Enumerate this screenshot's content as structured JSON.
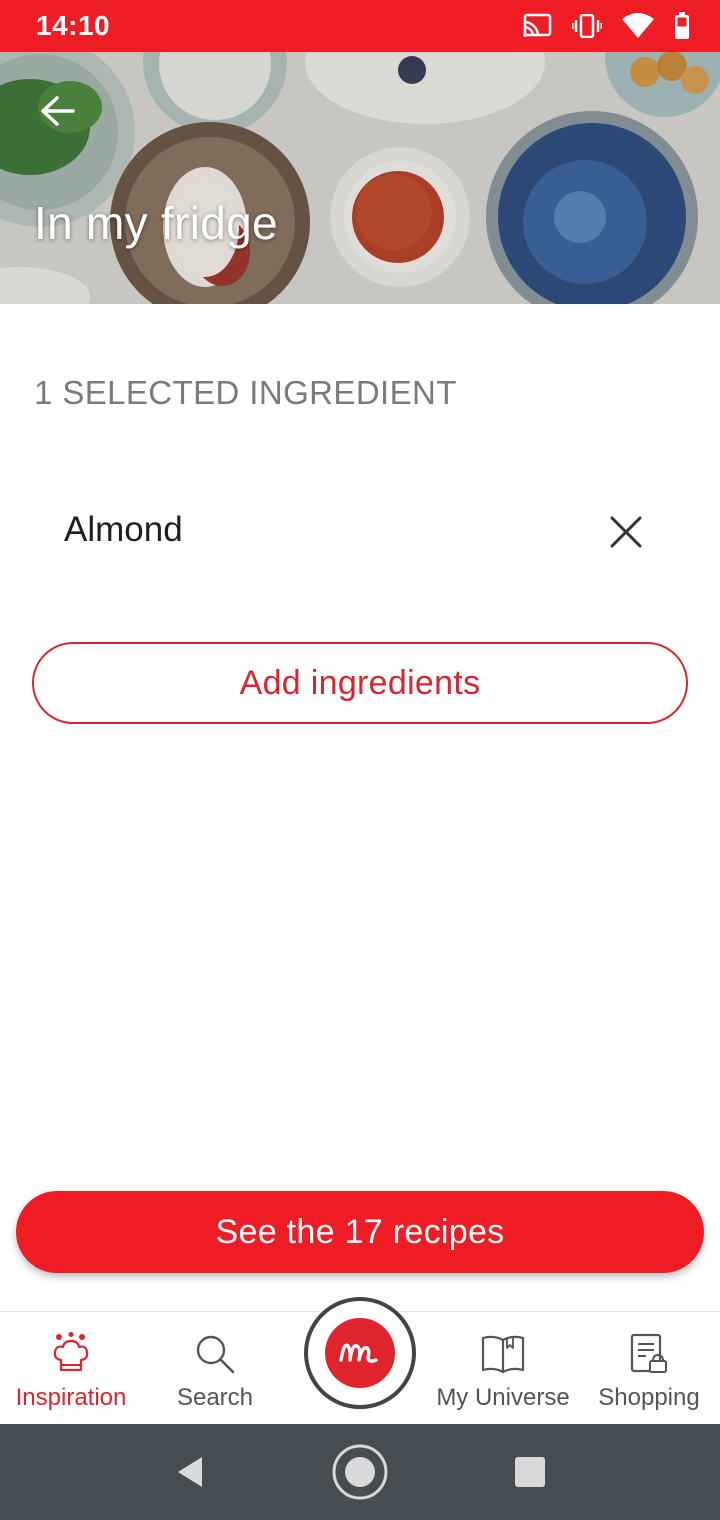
{
  "status_bar": {
    "time": "14:10",
    "icons": [
      "cast-icon",
      "vibrate-icon",
      "wifi-icon",
      "battery-icon"
    ]
  },
  "header": {
    "title": "In my fridge",
    "back_icon": "arrow-left-icon"
  },
  "ingredients": {
    "heading": "1 SELECTED INGREDIENT",
    "items": [
      {
        "name": "Almond",
        "remove_icon": "close-icon"
      }
    ],
    "add_label": "Add ingredients"
  },
  "cta": {
    "label": "See the 17 recipes"
  },
  "bottom_nav": {
    "items": [
      {
        "label": "Inspiration",
        "icon": "chef-hat-icon",
        "active": true
      },
      {
        "label": "Search",
        "icon": "search-icon",
        "active": false
      },
      {
        "label": "",
        "icon": "brand-logo-icon",
        "active": false
      },
      {
        "label": "My Universe",
        "icon": "book-icon",
        "active": false
      },
      {
        "label": "Shopping",
        "icon": "shopping-list-icon",
        "active": false
      }
    ]
  },
  "system_nav": {
    "icons": [
      "nav-back-icon",
      "nav-home-icon",
      "nav-recents-icon"
    ]
  },
  "colors": {
    "brand_red": "#ee1c25",
    "accent_red": "#e0242d",
    "system_nav_bg": "#454c52"
  }
}
